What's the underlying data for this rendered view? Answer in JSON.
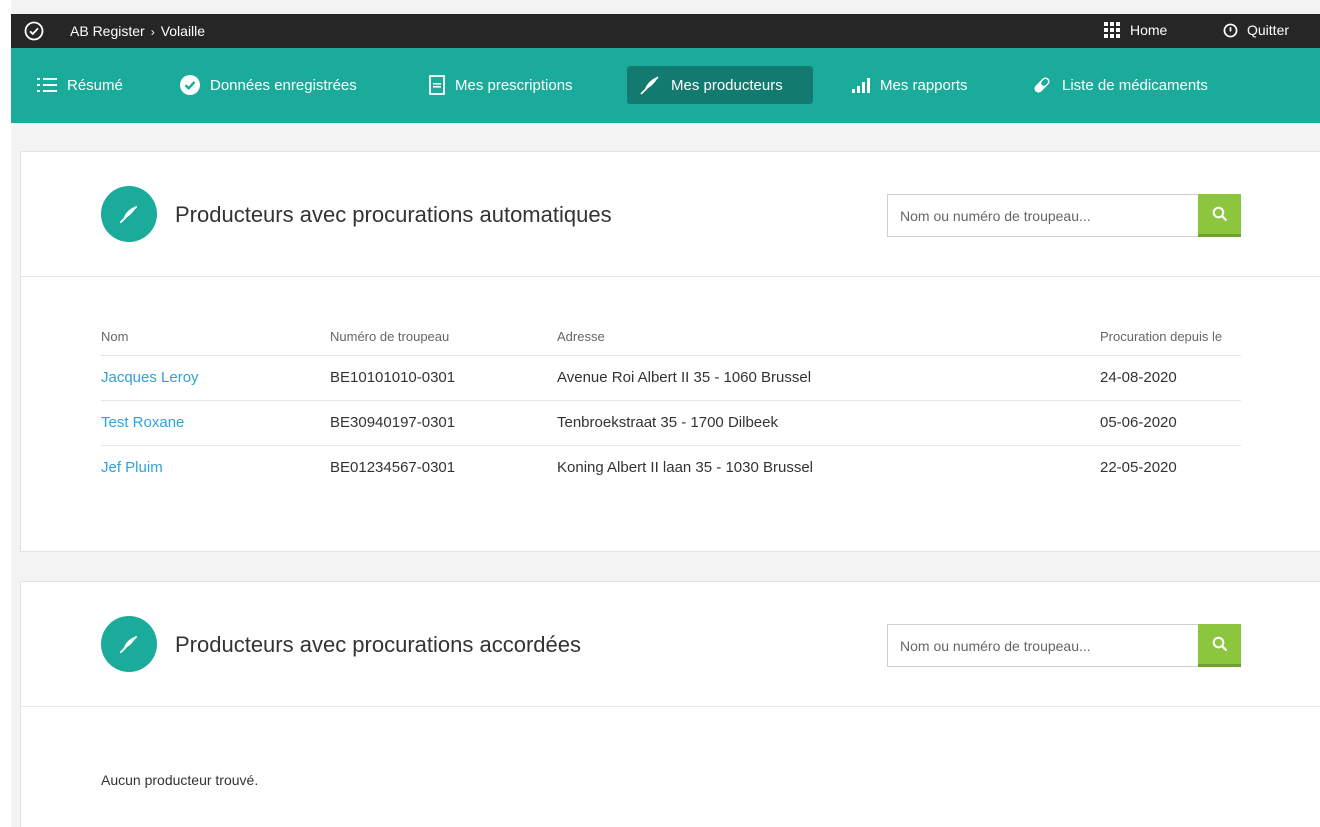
{
  "topbar": {
    "breadcrumb": [
      "AB Register",
      "Volaille"
    ],
    "home_label": "Home",
    "quit_label": "Quitter"
  },
  "nav": {
    "items": [
      {
        "label": "Résumé",
        "icon": "list-icon"
      },
      {
        "label": "Données enregistrées",
        "icon": "check-circle-icon"
      },
      {
        "label": "Mes prescriptions",
        "icon": "document-icon"
      },
      {
        "label": "Mes producteurs",
        "icon": "feather-icon",
        "active": true
      },
      {
        "label": "Mes rapports",
        "icon": "bar-chart-icon"
      },
      {
        "label": "Liste de médicaments",
        "icon": "pill-icon"
      }
    ]
  },
  "auto": {
    "title": "Producteurs avec procurations automatiques",
    "search_placeholder": "Nom ou numéro de troupeau...",
    "columns": [
      "Nom",
      "Numéro de troupeau",
      "Adresse",
      "Procuration depuis le"
    ],
    "rows": [
      {
        "name": "Jacques Leroy",
        "herd": "BE10101010-0301",
        "address": "Avenue Roi Albert II 35 - 1060 Brussel",
        "since": "24-08-2020"
      },
      {
        "name": "Test Roxane",
        "herd": "BE30940197-0301",
        "address": "Tenbroekstraat 35 - 1700 Dilbeek",
        "since": "05-06-2020"
      },
      {
        "name": "Jef Pluim",
        "herd": "BE01234567-0301",
        "address": "Koning Albert II laan 35 - 1030 Brussel",
        "since": "22-05-2020"
      }
    ]
  },
  "granted": {
    "title": "Producteurs avec procurations accordées",
    "search_placeholder": "Nom ou numéro de troupeau...",
    "empty_message": "Aucun producteur trouvé."
  },
  "colors": {
    "nav_bg": "#1aab9b",
    "nav_active": "#137a70",
    "topbar_bg": "#262626",
    "link": "#2ea3d9",
    "search_button": "#8cc63f"
  }
}
